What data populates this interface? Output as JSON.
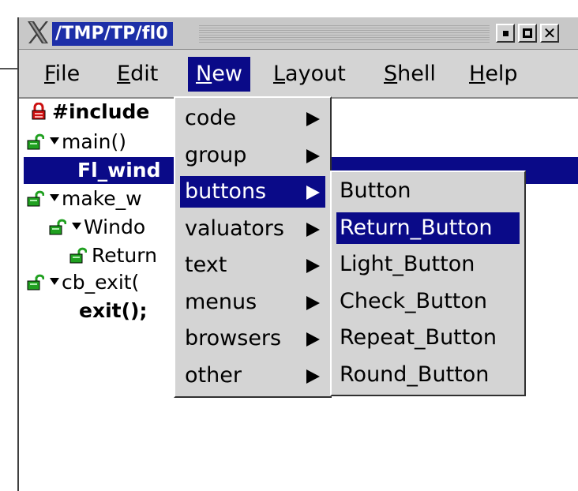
{
  "window": {
    "title": "/TMP/TP/fl0",
    "buttons": [
      "minimize",
      "maximize",
      "close"
    ]
  },
  "menubar": {
    "items": [
      {
        "label": "File",
        "mnemonic": "F",
        "rest": "ile"
      },
      {
        "label": "Edit",
        "mnemonic": "E",
        "rest": "dit"
      },
      {
        "label": "New",
        "mnemonic": "N",
        "rest": "ew",
        "active": true
      },
      {
        "label": "Layout",
        "mnemonic": "L",
        "rest": "ayout"
      },
      {
        "label": "Shell",
        "mnemonic": "S",
        "rest": "hell"
      },
      {
        "label": "Help",
        "mnemonic": "H",
        "rest": "elp"
      }
    ]
  },
  "tree": {
    "rows": [
      {
        "text": "#include",
        "icon": "red-lock-icon",
        "bold": true
      },
      {
        "text": "main()",
        "icon": "green-lock-icon",
        "expander": true
      },
      {
        "text": "Fl_wind",
        "selected": true,
        "bold": true
      },
      {
        "text": "make_w",
        "icon": "green-lock-icon",
        "expander": true
      },
      {
        "text": "Windo",
        "icon": "green-lock-icon",
        "expander": true
      },
      {
        "text": "Return",
        "icon": "green-lock-icon"
      },
      {
        "text": "cb_exit(",
        "icon": "green-lock-icon",
        "expander": true
      },
      {
        "text": "exit();",
        "bold": true
      }
    ]
  },
  "new_menu": {
    "items": [
      "code",
      "group",
      "buttons",
      "valuators",
      "text",
      "menus",
      "browsers",
      "other"
    ],
    "highlighted": "buttons"
  },
  "buttons_submenu": {
    "items": [
      "Button",
      "Return_Button",
      "Light_Button",
      "Check_Button",
      "Repeat_Button",
      "Round_Button"
    ],
    "highlighted": "Return_Button"
  },
  "colors": {
    "selection": "#0a0a88",
    "title_bg": "#1d2fa8",
    "menu_bg": "#d4d4d4",
    "red_lock": "#cc1010",
    "green_lock": "#20a020"
  }
}
